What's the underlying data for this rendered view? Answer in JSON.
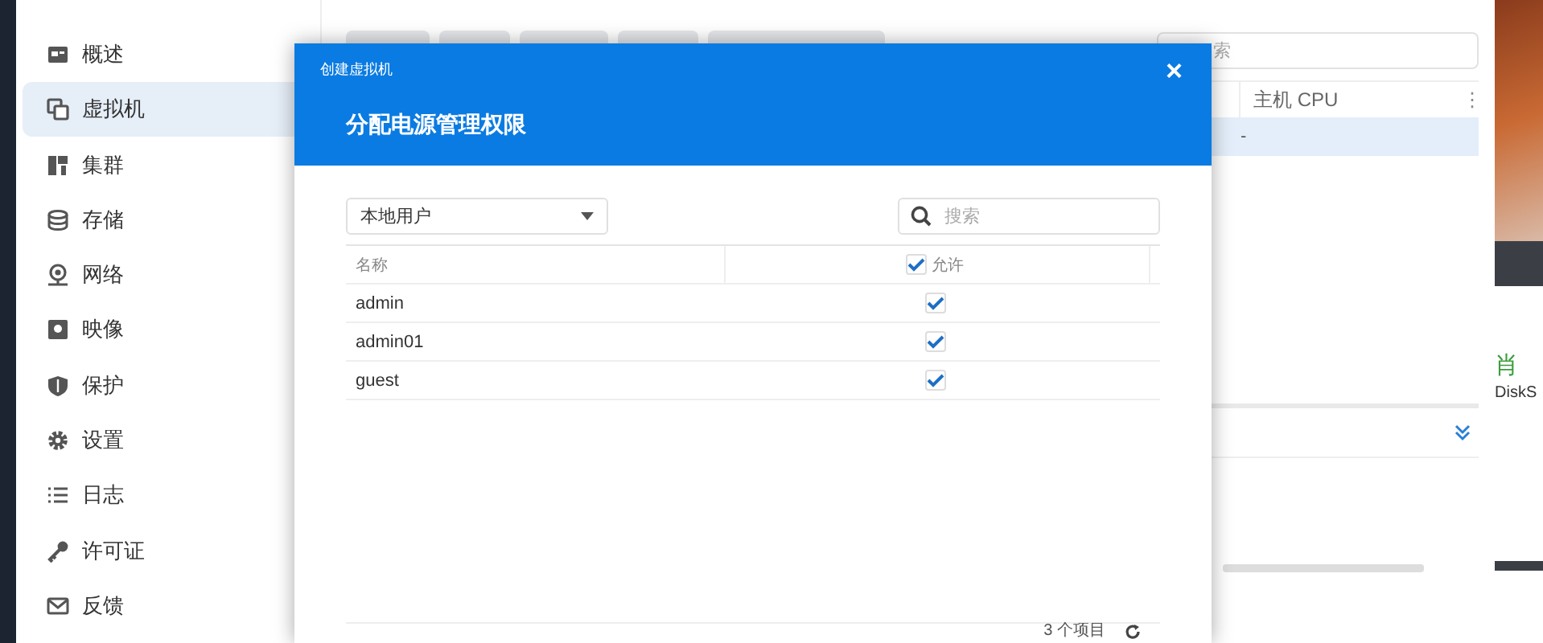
{
  "sidebar": {
    "items": [
      {
        "label": "概述",
        "selected": false
      },
      {
        "label": "虚拟机",
        "selected": true
      },
      {
        "label": "集群",
        "selected": false
      },
      {
        "label": "存储",
        "selected": false
      },
      {
        "label": "网络",
        "selected": false
      },
      {
        "label": "映像",
        "selected": false
      },
      {
        "label": "保护",
        "selected": false
      },
      {
        "label": "设置",
        "selected": false
      },
      {
        "label": "日志",
        "selected": false
      },
      {
        "label": "许可证",
        "selected": false
      },
      {
        "label": "反馈",
        "selected": false
      }
    ]
  },
  "main": {
    "search": {
      "placeholder": "索"
    },
    "table": {
      "columns": [
        "主机 CPU"
      ],
      "rows": [
        {
          "cells": [
            "-"
          ],
          "selected": true
        }
      ],
      "menu": "⋮"
    }
  },
  "side_panel": {
    "status": "肖",
    "caption": "DiskS"
  },
  "dialog": {
    "window_title": "创建虚拟机",
    "title": "分配电源管理权限",
    "close": "×",
    "filter": {
      "value": "本地用户"
    },
    "search": {
      "placeholder": "搜索"
    },
    "table": {
      "columns": [
        {
          "label": "名称"
        },
        {
          "label": "允许",
          "checked": true
        }
      ],
      "rows": [
        {
          "name": "admin",
          "allowed": true
        },
        {
          "name": "admin01",
          "allowed": true
        },
        {
          "name": "guest",
          "allowed": true
        }
      ]
    },
    "footer": {
      "count": "3 个项目"
    }
  }
}
